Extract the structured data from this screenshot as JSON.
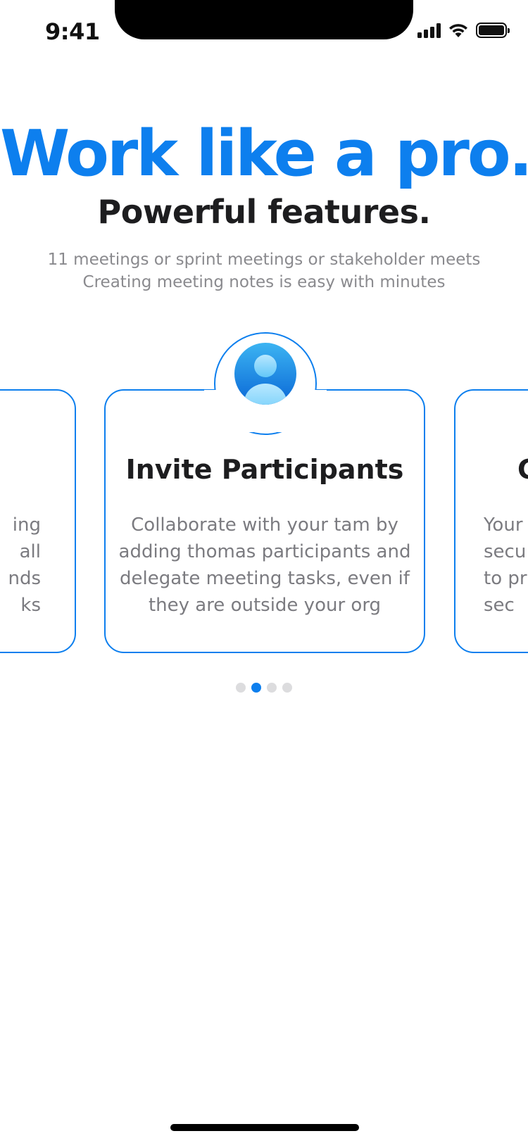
{
  "status_bar": {
    "time": "9:41"
  },
  "hero": {
    "headline": "Work like a pro.",
    "subheadline": "Powerful features.",
    "description_lines": [
      "11 meetings or sprint meetings or stakeholder meets",
      "Creating meeting notes is easy with minutes"
    ]
  },
  "carousel": {
    "active_index": 1,
    "page_count": 4,
    "cards": [
      {
        "title": "",
        "body_lines": [
          "ing",
          "all",
          "nds",
          "ks"
        ]
      },
      {
        "title": "Invite Participants",
        "body_lines": [
          "Collaborate with your tam by",
          "adding thomas participants and",
          "delegate meeting tasks, even if",
          "they are outside your org"
        ]
      },
      {
        "title": "C",
        "body_lines": [
          "Your",
          "secu",
          "to pr",
          "sec"
        ]
      }
    ]
  },
  "colors": {
    "accent": "#0d7fee",
    "title": "#1d1d1f",
    "muted": "#8a8a8e",
    "dot_inactive": "#dcdcde"
  },
  "icons": {
    "card_icon": "user-avatar-icon"
  }
}
